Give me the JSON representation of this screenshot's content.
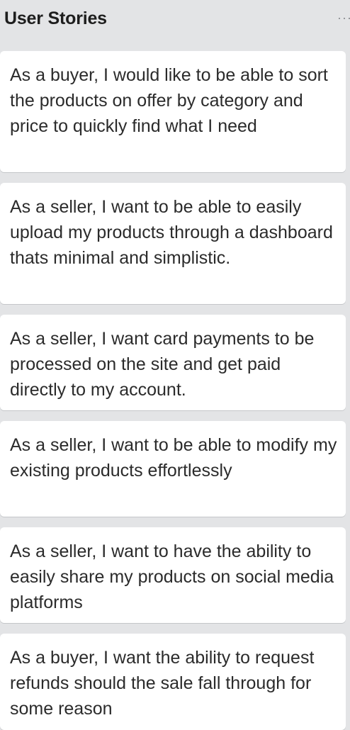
{
  "list": {
    "title": "User Stories",
    "menu_icon": "more-icon"
  },
  "cards": [
    {
      "text": "As a buyer, I would like to be able to sort the products on offer by category and price to quickly find what I need"
    },
    {
      "text": "As a seller, I want to be able to easily upload my products through a dashboard thats minimal and simplistic."
    },
    {
      "text": "As a seller, I want card payments to be processed on the site and get paid directly to my account."
    },
    {
      "text": "As a seller, I want to be able to modify my existing products effortlessly"
    },
    {
      "text": "As a seller, I want to have the ability to easily share my products on social media platforms"
    },
    {
      "text": "As a buyer, I want the ability to request refunds should the sale fall through for some reason"
    }
  ]
}
